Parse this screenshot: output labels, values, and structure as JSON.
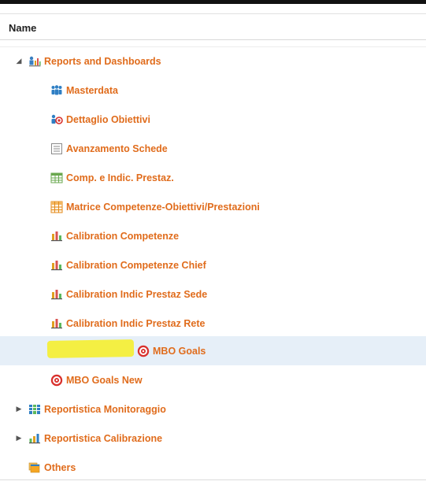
{
  "table": {
    "header": "Name"
  },
  "tree": {
    "reports": {
      "label": "Reports and Dashboards",
      "expanded": true
    },
    "children": {
      "masterdata": "Masterdata",
      "dettaglio": "Dettaglio Obiettivi",
      "avanzamento": "Avanzamento Schede",
      "comp_indic": "Comp. e Indic. Prestaz.",
      "matrice": "Matrice Competenze-Obiettivi/Prestazioni",
      "cal_comp": "Calibration Competenze",
      "cal_comp_chief": "Calibration Competenze Chief",
      "cal_sede": "Calibration Indic Prestaz Sede",
      "cal_rete": "Calibration Indic Prestaz Rete",
      "mbo_goals": "MBO Goals",
      "mbo_goals_new": "MBO Goals New"
    },
    "monitoraggio": {
      "label": "Reportistica Monitoraggio",
      "expanded": false
    },
    "calibrazione": {
      "label": "Reportistica Calibrazione",
      "expanded": false
    },
    "others": {
      "label": "Others"
    }
  },
  "colors": {
    "link": "#e06c1c",
    "selected_row": "#e6eff8",
    "highlight": "#f6ee23"
  }
}
